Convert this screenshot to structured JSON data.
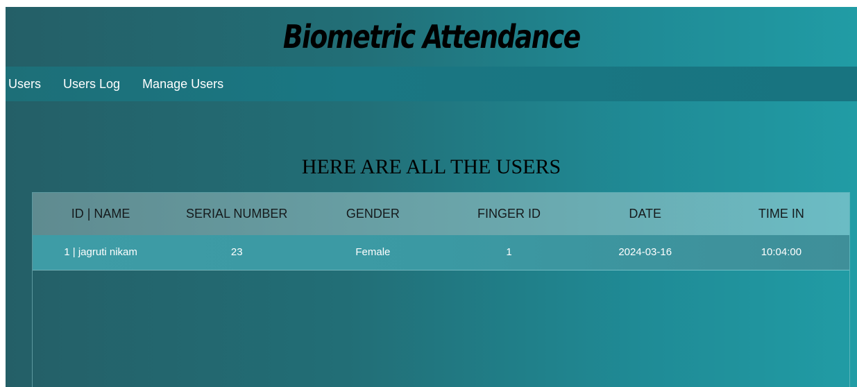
{
  "header": {
    "title": "Biometric Attendance"
  },
  "nav": {
    "items": [
      {
        "label": "Users"
      },
      {
        "label": "Users Log"
      },
      {
        "label": "Manage Users"
      }
    ]
  },
  "main": {
    "title": "HERE ARE ALL THE USERS",
    "table": {
      "columns": [
        "ID | NAME",
        "SERIAL NUMBER",
        "GENDER",
        "FINGER ID",
        "DATE",
        "TIME IN"
      ],
      "rows": [
        [
          "1 | jagruti nikam",
          "23",
          "Female",
          "1",
          "2024-03-16",
          "10:04:00"
        ]
      ]
    }
  },
  "colors": {
    "header_bg": "#245f67",
    "nav_bg": "#1a7783",
    "table_header_bg": "#6aa3a8",
    "table_row_bg": "#3e9ca6"
  }
}
